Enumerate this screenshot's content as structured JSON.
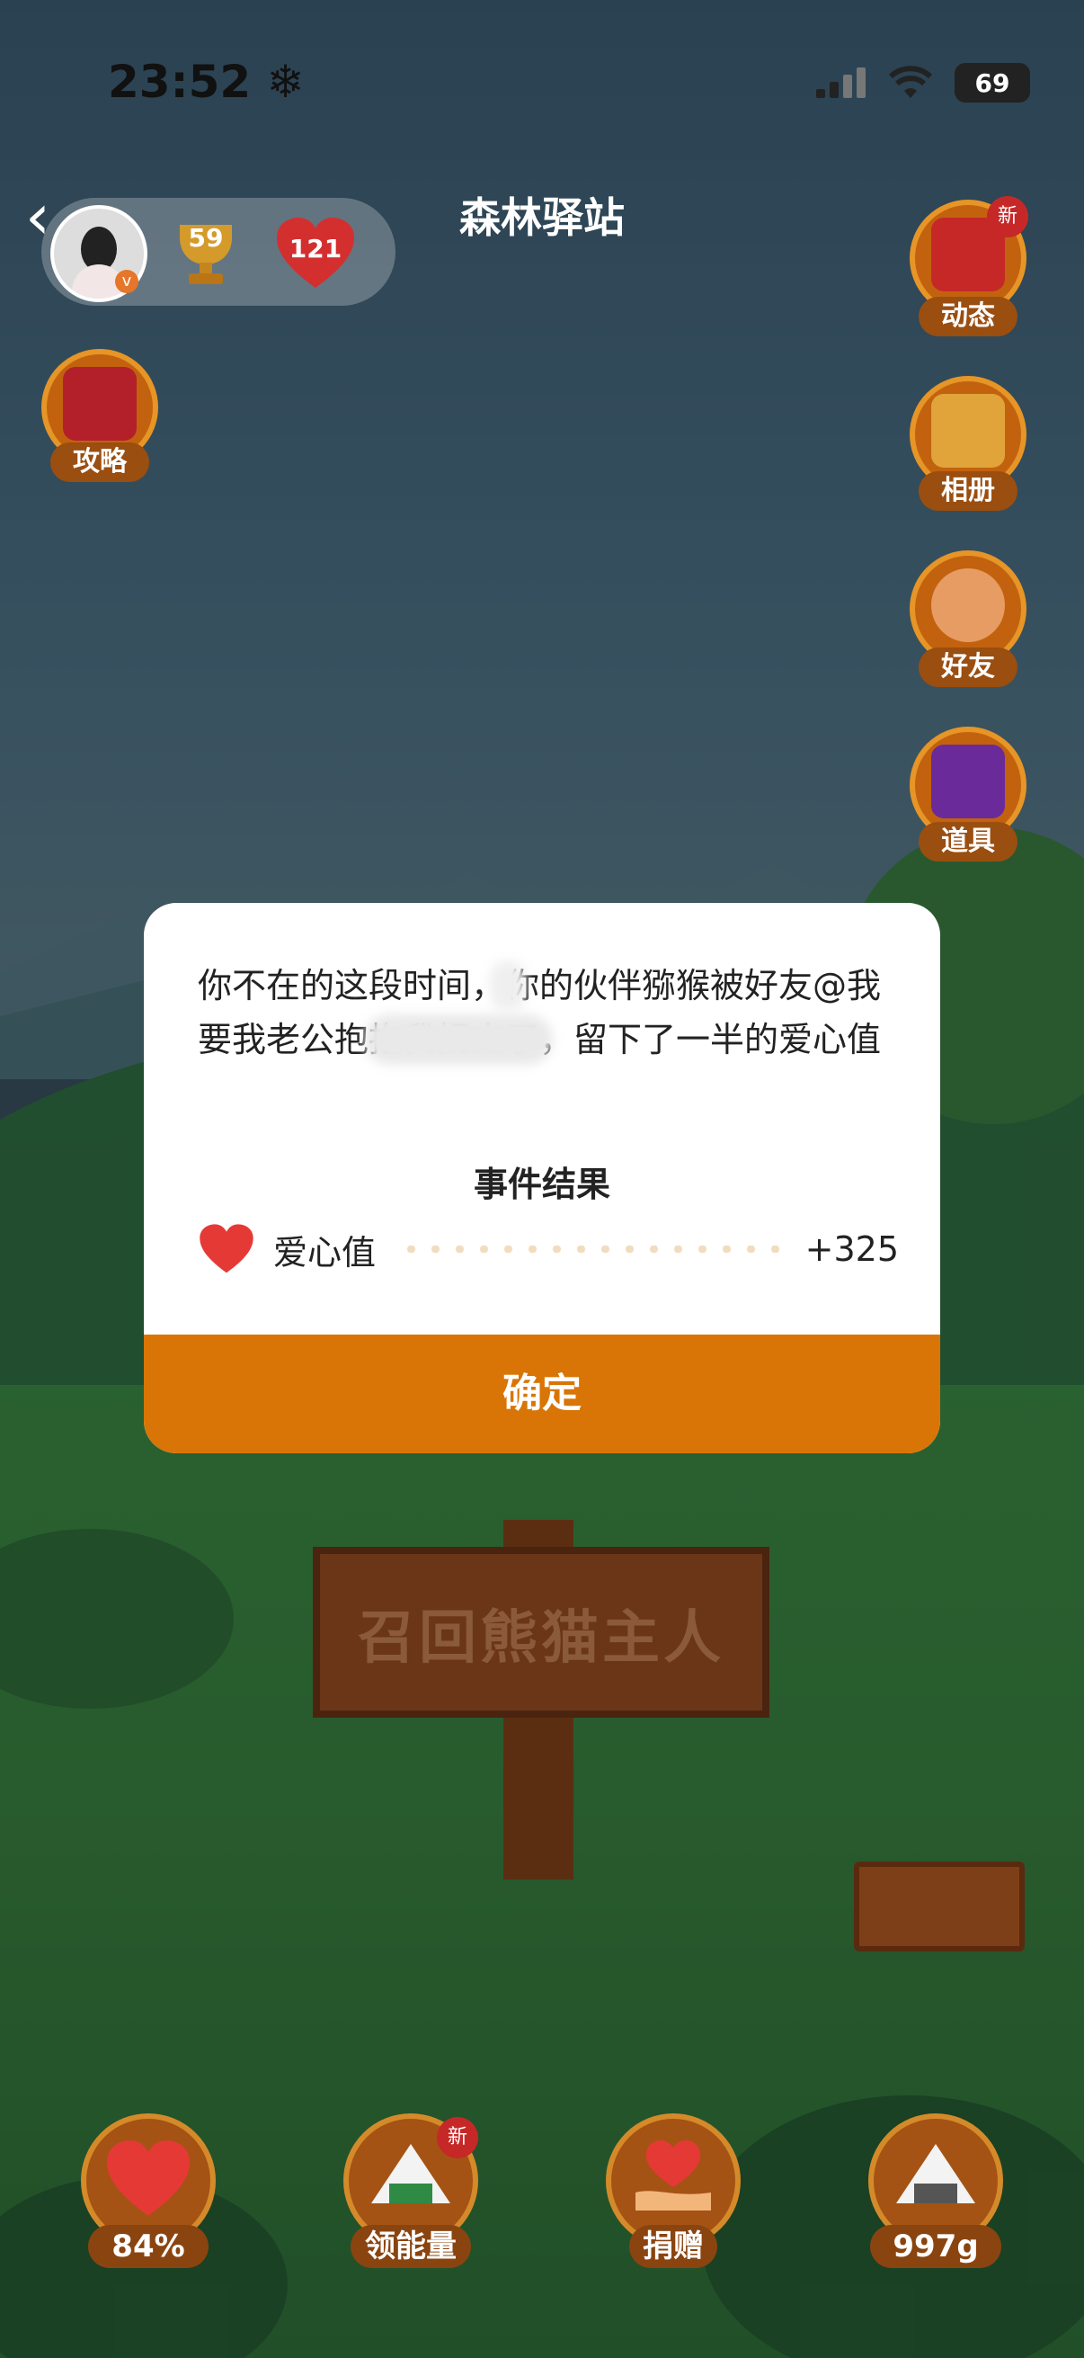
{
  "status_bar": {
    "time": "23:52",
    "time_icon": "snowflake-icon",
    "battery": "69"
  },
  "header": {
    "title": "森林驿站",
    "trophy_count": "59",
    "heart_count": "121"
  },
  "side_buttons": {
    "strategy": "攻略",
    "feed": "动态",
    "feed_badge": "新",
    "album": "相册",
    "friends": "好友",
    "items": "道具"
  },
  "sign": {
    "text": "召回熊猫主人"
  },
  "modal": {
    "message": "你不在的这段时间，你的伙伴猕猴被好友@我要我老公抱抱我拐走了，留下了一半的爱心值",
    "event_title": "事件结果",
    "result_label": "爱心值",
    "result_value": "+325",
    "confirm_label": "确定"
  },
  "bottom_bar": {
    "love_percent": "84%",
    "energy_label": "领能量",
    "energy_badge": "新",
    "donate_label": "捐赠",
    "food_amount": "997g"
  },
  "colors": {
    "accent": "#d97506",
    "heart": "#e53935"
  }
}
